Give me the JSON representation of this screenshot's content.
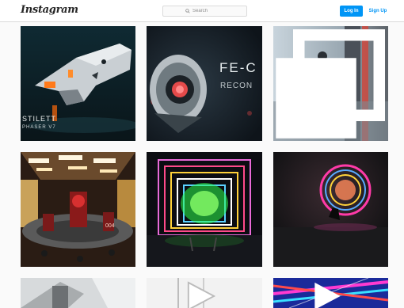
{
  "header": {
    "logo": "Instagram",
    "search_placeholder": "Search",
    "login_label": "Log In",
    "signup_label": "Sign Up"
  },
  "posts": [
    {
      "caption_lines": [
        "STILETT",
        "PHASER V7"
      ]
    },
    {
      "caption_lines": [
        "FE-C",
        "RECON"
      ]
    },
    {
      "caption_lines": []
    },
    {
      "caption_lines": [
        "004"
      ]
    },
    {
      "caption_lines": []
    },
    {
      "caption_lines": []
    }
  ],
  "colors": {
    "accent": "#0095f6",
    "bg": "#fafafa",
    "border": "#dbdbdb"
  },
  "icons": [
    "search-icon",
    "multiple-photos-icon",
    "video-icon"
  ]
}
